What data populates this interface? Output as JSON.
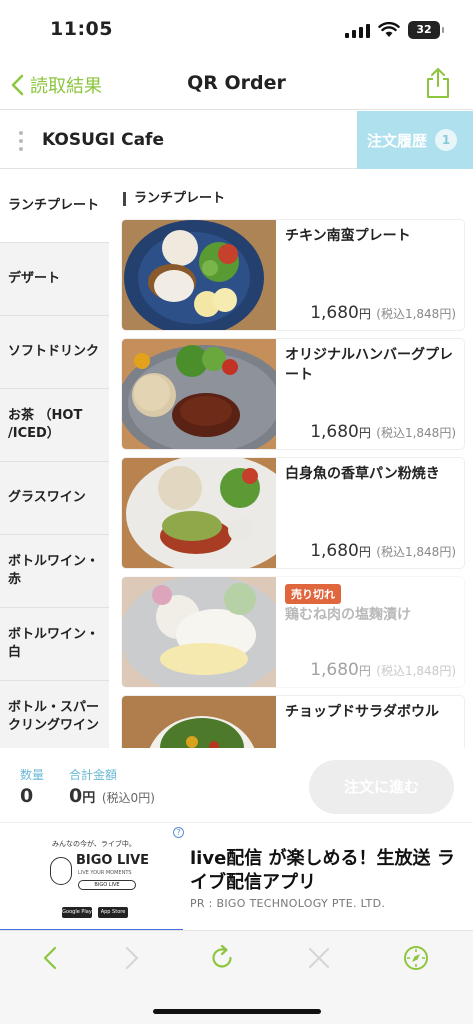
{
  "status_bar": {
    "time": "11:05",
    "battery": "32"
  },
  "nav": {
    "back_label": "読取結果",
    "title": "QR Order"
  },
  "store": {
    "name": "KOSUGI Cafe",
    "history_label": "注文履歴",
    "history_count": "1"
  },
  "categories": [
    "ランチプレート",
    "デザート",
    "ソフトドリンク",
    "お茶 （HOT /ICED）",
    "グラスワイン",
    "ボトルワイン・赤",
    "ボトルワイン・白",
    "ボトル・スパークリングワイン"
  ],
  "section_title": "ランチプレート",
  "items": [
    {
      "name": "チキン南蛮プレート",
      "price": "1,680",
      "yen": "円",
      "tax_price": "(税込1,848円)",
      "sold_out": false,
      "badge": ""
    },
    {
      "name": "オリジナルハンバーグプレート",
      "price": "1,680",
      "yen": "円",
      "tax_price": "(税込1,848円)",
      "sold_out": false,
      "badge": ""
    },
    {
      "name": "白身魚の香草パン粉焼き",
      "price": "1,680",
      "yen": "円",
      "tax_price": "(税込1,848円)",
      "sold_out": false,
      "badge": ""
    },
    {
      "name": "鶏むね肉の塩麹漬け",
      "price": "1,680",
      "yen": "円",
      "tax_price": "(税込1,848円)",
      "sold_out": true,
      "badge": "売り切れ"
    },
    {
      "name": "チョップドサラダボウル",
      "price": "",
      "yen": "",
      "tax_price": "",
      "sold_out": false,
      "badge": ""
    }
  ],
  "order_bar": {
    "qty_label": "数量",
    "qty_value": "0",
    "total_label": "合計金額",
    "total_value": "0",
    "total_yen": "円",
    "total_tax": "(税込0円)",
    "order_button": "注文に進む"
  },
  "ad": {
    "title": "live配信 が楽しめる！生放送 ライブ配信アプリ",
    "pr": "PR : BIGO TECHNOLOGY PTE. LTD.",
    "image_tagline": "みんなの今が、ライブ中。",
    "image_logo": "BIGO LIVE",
    "image_sub": "LIVE YOUR MOMENTS",
    "image_search": "BIGO LIVE",
    "image_store1": "Google Play",
    "image_store2": "App Store",
    "info_mark": "?"
  },
  "colors": {
    "accent_green": "#8cc63f",
    "history_bg": "#aee0ee",
    "soldout_badge": "#e0663d",
    "label_blue": "#6cb9d6"
  }
}
